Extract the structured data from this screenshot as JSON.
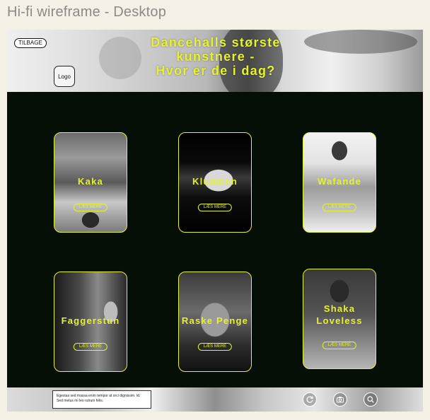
{
  "frame": {
    "title": "Hi-fi wireframe - Desktop"
  },
  "header": {
    "back_label": "TILBAGE",
    "logo_label": "Logo",
    "headline": [
      "Dancehalls største",
      "kunstnere -",
      "Hvor er de i dag?"
    ]
  },
  "artists": [
    {
      "name": "Kaka",
      "more_label": "LÆS MERE"
    },
    {
      "name": "Klumben",
      "more_label": "LÆS MERE"
    },
    {
      "name": "Wafande",
      "more_label": "LÆS MERE"
    },
    {
      "name": "Faggerstun",
      "more_label": "LÆS MERE"
    },
    {
      "name": "Raske Penge",
      "more_label": "LÆS MERE"
    },
    {
      "name": "Shaka Loveless",
      "more_label": "LÆS MERE"
    }
  ],
  "footer": {
    "text": "Egestas sed massa enim tempor at orci dignissim. Id. Sed metus mi leo rutrum felis.",
    "icons": [
      "refresh-icon",
      "camera-icon",
      "search-icon"
    ]
  },
  "colors": {
    "accent": "#e4f233",
    "background": "#060f06",
    "page": "#f4f0e6"
  }
}
